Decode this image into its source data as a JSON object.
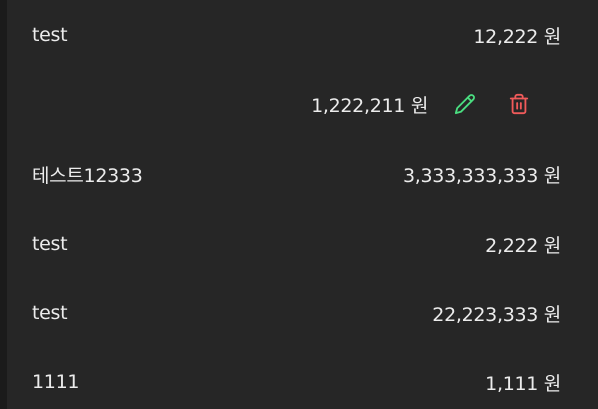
{
  "colors": {
    "background": "#262626",
    "text": "#ececec",
    "edit_icon": "#4ade80",
    "delete_icon": "#f05a5a"
  },
  "expenses": [
    {
      "name": "test",
      "amount": "12,222 원"
    },
    {
      "name": "",
      "amount": "1,222,211 원",
      "editing": true,
      "icons": [
        "pencil-icon",
        "trash-icon"
      ]
    },
    {
      "name": "테스트12333",
      "amount": "3,333,333,333 원"
    },
    {
      "name": "test",
      "amount": "2,222 원"
    },
    {
      "name": "test",
      "amount": "22,223,333 원"
    },
    {
      "name": "1111",
      "amount": "1,111 원"
    }
  ]
}
